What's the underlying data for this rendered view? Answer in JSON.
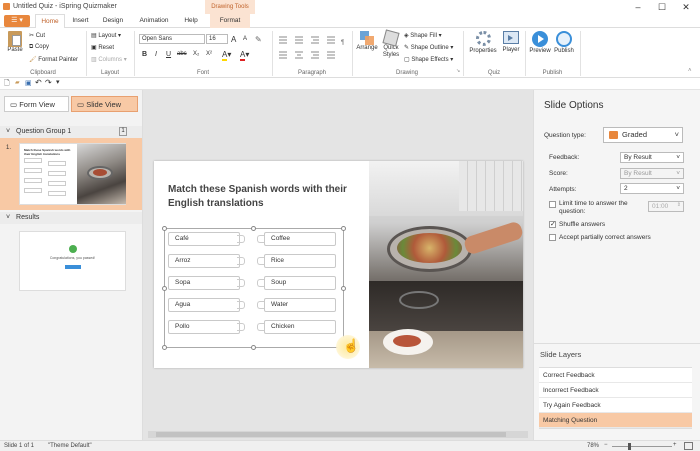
{
  "window": {
    "title": "Untitled Quiz - iSpring Quizmaker",
    "context_tab": "Drawing Tools"
  },
  "tabs": [
    {
      "label": "Home"
    },
    {
      "label": "Insert"
    },
    {
      "label": "Design"
    },
    {
      "label": "Animation"
    },
    {
      "label": "Help"
    },
    {
      "label": "Format"
    }
  ],
  "ribbon": {
    "clipboard": {
      "paste": "Paste",
      "cut": "Cut",
      "copy": "Copy",
      "format_painter": "Format Painter",
      "label": "Clipboard"
    },
    "layout": {
      "layout": "Layout",
      "reset": "Reset",
      "columns": "Columns",
      "label": "Layout"
    },
    "font": {
      "family": "Open Sans",
      "size": "16",
      "bold": "B",
      "italic": "I",
      "underline": "U",
      "strike": "abc",
      "sub": "X₂",
      "sup": "X²",
      "grow": "A",
      "shrink": "A",
      "label": "Font"
    },
    "paragraph": {
      "label": "Paragraph"
    },
    "drawing": {
      "arrange": "Arrange",
      "quick_styles": "Quick Styles",
      "shape_fill": "Shape Fill",
      "shape_outline": "Shape Outline",
      "shape_effects": "Shape Effects",
      "label": "Drawing"
    },
    "quiz": {
      "properties": "Properties",
      "player": "Player",
      "label": "Quiz"
    },
    "publish": {
      "preview": "Preview",
      "publish": "Publish",
      "label": "Publish"
    }
  },
  "left": {
    "form_view": "Form View",
    "slide_view": "Slide View",
    "group1": {
      "title": "Question Group 1",
      "count": "1"
    },
    "slide_number": "1.",
    "thumb_title": "Match these Spanish words with their English translations",
    "results": "Results",
    "results_text": "Congratulations, you passed!"
  },
  "slide": {
    "title": "Match these Spanish words with their English translations",
    "left_words": [
      "Café",
      "Arroz",
      "Sopa",
      "Agua",
      "Pollo"
    ],
    "right_words": [
      "Coffee",
      "Rice",
      "Soup",
      "Water",
      "Chicken"
    ]
  },
  "right": {
    "header": "Slide Options",
    "question_type_label": "Question type:",
    "question_type": "Graded",
    "feedback_label": "Feedback:",
    "feedback": "By Result",
    "score_label": "Score:",
    "score": "By Result",
    "attempts_label": "Attempts:",
    "attempts": "2",
    "limit_time": "Limit time to answer the question:",
    "time_value": "01:00",
    "shuffle": "Shuffle answers",
    "partial": "Accept partially correct answers",
    "layers_header": "Slide Layers",
    "layers": [
      "Correct Feedback",
      "Incorrect Feedback",
      "Try Again Feedback",
      "Matching Question"
    ]
  },
  "status": {
    "slide": "Slide 1 of 1",
    "theme": "\"Theme Default\"",
    "zoom": "78%"
  },
  "colors": {
    "accent": "#e8873d",
    "selected": "#f8c9a5"
  }
}
